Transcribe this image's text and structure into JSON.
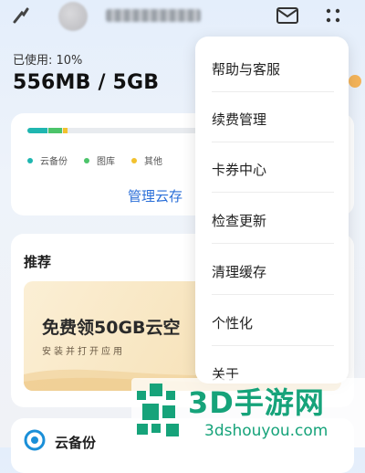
{
  "header": {
    "back_icon": "back-arrow-icon",
    "mail_icon": "mail-icon",
    "more_icon": "more-grid-icon"
  },
  "usage": {
    "label": "已使用: 10%",
    "value": "556MB / 5GB",
    "percent_used": 10
  },
  "storage": {
    "legend": [
      {
        "label": "云备份",
        "color": "#1fb6b0"
      },
      {
        "label": "图库",
        "color": "#4cc46a"
      },
      {
        "label": "其他",
        "color": "#f2c12e"
      }
    ],
    "manage_label": "管理云存"
  },
  "recommend": {
    "title": "推荐",
    "promo_title": "免费领50GB云空",
    "promo_subtitle": "安装并打开应用"
  },
  "backup": {
    "label": "云备份",
    "icon": "cloud-backup-icon"
  },
  "menu": {
    "items": [
      {
        "label": "帮助与客服"
      },
      {
        "label": "续费管理"
      },
      {
        "label": "卡券中心"
      },
      {
        "label": "检查更新"
      },
      {
        "label": "清理缓存"
      },
      {
        "label": "个性化"
      },
      {
        "label": "关于"
      }
    ]
  },
  "watermark": {
    "title": "3D手游网",
    "url": "3dshouyou.com",
    "accent": "#16a37a"
  }
}
